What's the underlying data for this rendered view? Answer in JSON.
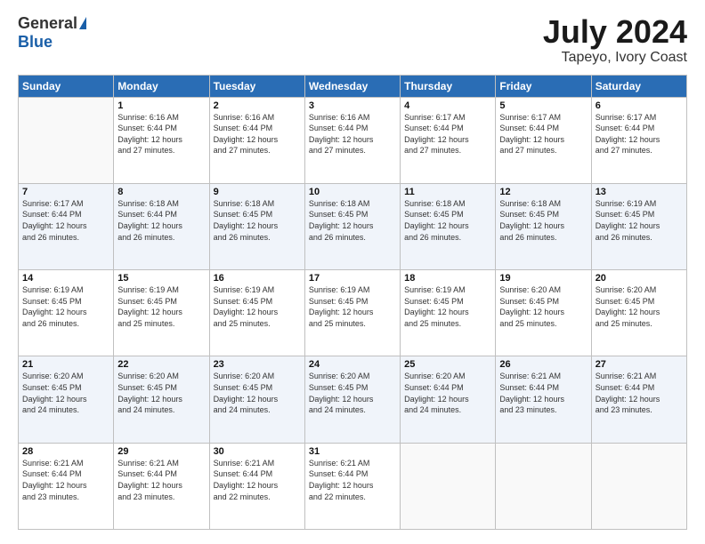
{
  "logo": {
    "general": "General",
    "blue": "Blue"
  },
  "header": {
    "month": "July 2024",
    "location": "Tapeyo, Ivory Coast"
  },
  "weekdays": [
    "Sunday",
    "Monday",
    "Tuesday",
    "Wednesday",
    "Thursday",
    "Friday",
    "Saturday"
  ],
  "weeks": [
    [
      {
        "day": "",
        "sunrise": "",
        "sunset": "",
        "daylight": ""
      },
      {
        "day": "1",
        "sunrise": "Sunrise: 6:16 AM",
        "sunset": "Sunset: 6:44 PM",
        "daylight": "Daylight: 12 hours and 27 minutes."
      },
      {
        "day": "2",
        "sunrise": "Sunrise: 6:16 AM",
        "sunset": "Sunset: 6:44 PM",
        "daylight": "Daylight: 12 hours and 27 minutes."
      },
      {
        "day": "3",
        "sunrise": "Sunrise: 6:16 AM",
        "sunset": "Sunset: 6:44 PM",
        "daylight": "Daylight: 12 hours and 27 minutes."
      },
      {
        "day": "4",
        "sunrise": "Sunrise: 6:17 AM",
        "sunset": "Sunset: 6:44 PM",
        "daylight": "Daylight: 12 hours and 27 minutes."
      },
      {
        "day": "5",
        "sunrise": "Sunrise: 6:17 AM",
        "sunset": "Sunset: 6:44 PM",
        "daylight": "Daylight: 12 hours and 27 minutes."
      },
      {
        "day": "6",
        "sunrise": "Sunrise: 6:17 AM",
        "sunset": "Sunset: 6:44 PM",
        "daylight": "Daylight: 12 hours and 27 minutes."
      }
    ],
    [
      {
        "day": "7",
        "sunrise": "Sunrise: 6:17 AM",
        "sunset": "Sunset: 6:44 PM",
        "daylight": "Daylight: 12 hours and 26 minutes."
      },
      {
        "day": "8",
        "sunrise": "Sunrise: 6:18 AM",
        "sunset": "Sunset: 6:44 PM",
        "daylight": "Daylight: 12 hours and 26 minutes."
      },
      {
        "day": "9",
        "sunrise": "Sunrise: 6:18 AM",
        "sunset": "Sunset: 6:45 PM",
        "daylight": "Daylight: 12 hours and 26 minutes."
      },
      {
        "day": "10",
        "sunrise": "Sunrise: 6:18 AM",
        "sunset": "Sunset: 6:45 PM",
        "daylight": "Daylight: 12 hours and 26 minutes."
      },
      {
        "day": "11",
        "sunrise": "Sunrise: 6:18 AM",
        "sunset": "Sunset: 6:45 PM",
        "daylight": "Daylight: 12 hours and 26 minutes."
      },
      {
        "day": "12",
        "sunrise": "Sunrise: 6:18 AM",
        "sunset": "Sunset: 6:45 PM",
        "daylight": "Daylight: 12 hours and 26 minutes."
      },
      {
        "day": "13",
        "sunrise": "Sunrise: 6:19 AM",
        "sunset": "Sunset: 6:45 PM",
        "daylight": "Daylight: 12 hours and 26 minutes."
      }
    ],
    [
      {
        "day": "14",
        "sunrise": "Sunrise: 6:19 AM",
        "sunset": "Sunset: 6:45 PM",
        "daylight": "Daylight: 12 hours and 26 minutes."
      },
      {
        "day": "15",
        "sunrise": "Sunrise: 6:19 AM",
        "sunset": "Sunset: 6:45 PM",
        "daylight": "Daylight: 12 hours and 25 minutes."
      },
      {
        "day": "16",
        "sunrise": "Sunrise: 6:19 AM",
        "sunset": "Sunset: 6:45 PM",
        "daylight": "Daylight: 12 hours and 25 minutes."
      },
      {
        "day": "17",
        "sunrise": "Sunrise: 6:19 AM",
        "sunset": "Sunset: 6:45 PM",
        "daylight": "Daylight: 12 hours and 25 minutes."
      },
      {
        "day": "18",
        "sunrise": "Sunrise: 6:19 AM",
        "sunset": "Sunset: 6:45 PM",
        "daylight": "Daylight: 12 hours and 25 minutes."
      },
      {
        "day": "19",
        "sunrise": "Sunrise: 6:20 AM",
        "sunset": "Sunset: 6:45 PM",
        "daylight": "Daylight: 12 hours and 25 minutes."
      },
      {
        "day": "20",
        "sunrise": "Sunrise: 6:20 AM",
        "sunset": "Sunset: 6:45 PM",
        "daylight": "Daylight: 12 hours and 25 minutes."
      }
    ],
    [
      {
        "day": "21",
        "sunrise": "Sunrise: 6:20 AM",
        "sunset": "Sunset: 6:45 PM",
        "daylight": "Daylight: 12 hours and 24 minutes."
      },
      {
        "day": "22",
        "sunrise": "Sunrise: 6:20 AM",
        "sunset": "Sunset: 6:45 PM",
        "daylight": "Daylight: 12 hours and 24 minutes."
      },
      {
        "day": "23",
        "sunrise": "Sunrise: 6:20 AM",
        "sunset": "Sunset: 6:45 PM",
        "daylight": "Daylight: 12 hours and 24 minutes."
      },
      {
        "day": "24",
        "sunrise": "Sunrise: 6:20 AM",
        "sunset": "Sunset: 6:45 PM",
        "daylight": "Daylight: 12 hours and 24 minutes."
      },
      {
        "day": "25",
        "sunrise": "Sunrise: 6:20 AM",
        "sunset": "Sunset: 6:44 PM",
        "daylight": "Daylight: 12 hours and 24 minutes."
      },
      {
        "day": "26",
        "sunrise": "Sunrise: 6:21 AM",
        "sunset": "Sunset: 6:44 PM",
        "daylight": "Daylight: 12 hours and 23 minutes."
      },
      {
        "day": "27",
        "sunrise": "Sunrise: 6:21 AM",
        "sunset": "Sunset: 6:44 PM",
        "daylight": "Daylight: 12 hours and 23 minutes."
      }
    ],
    [
      {
        "day": "28",
        "sunrise": "Sunrise: 6:21 AM",
        "sunset": "Sunset: 6:44 PM",
        "daylight": "Daylight: 12 hours and 23 minutes."
      },
      {
        "day": "29",
        "sunrise": "Sunrise: 6:21 AM",
        "sunset": "Sunset: 6:44 PM",
        "daylight": "Daylight: 12 hours and 23 minutes."
      },
      {
        "day": "30",
        "sunrise": "Sunrise: 6:21 AM",
        "sunset": "Sunset: 6:44 PM",
        "daylight": "Daylight: 12 hours and 22 minutes."
      },
      {
        "day": "31",
        "sunrise": "Sunrise: 6:21 AM",
        "sunset": "Sunset: 6:44 PM",
        "daylight": "Daylight: 12 hours and 22 minutes."
      },
      {
        "day": "",
        "sunrise": "",
        "sunset": "",
        "daylight": ""
      },
      {
        "day": "",
        "sunrise": "",
        "sunset": "",
        "daylight": ""
      },
      {
        "day": "",
        "sunrise": "",
        "sunset": "",
        "daylight": ""
      }
    ]
  ]
}
